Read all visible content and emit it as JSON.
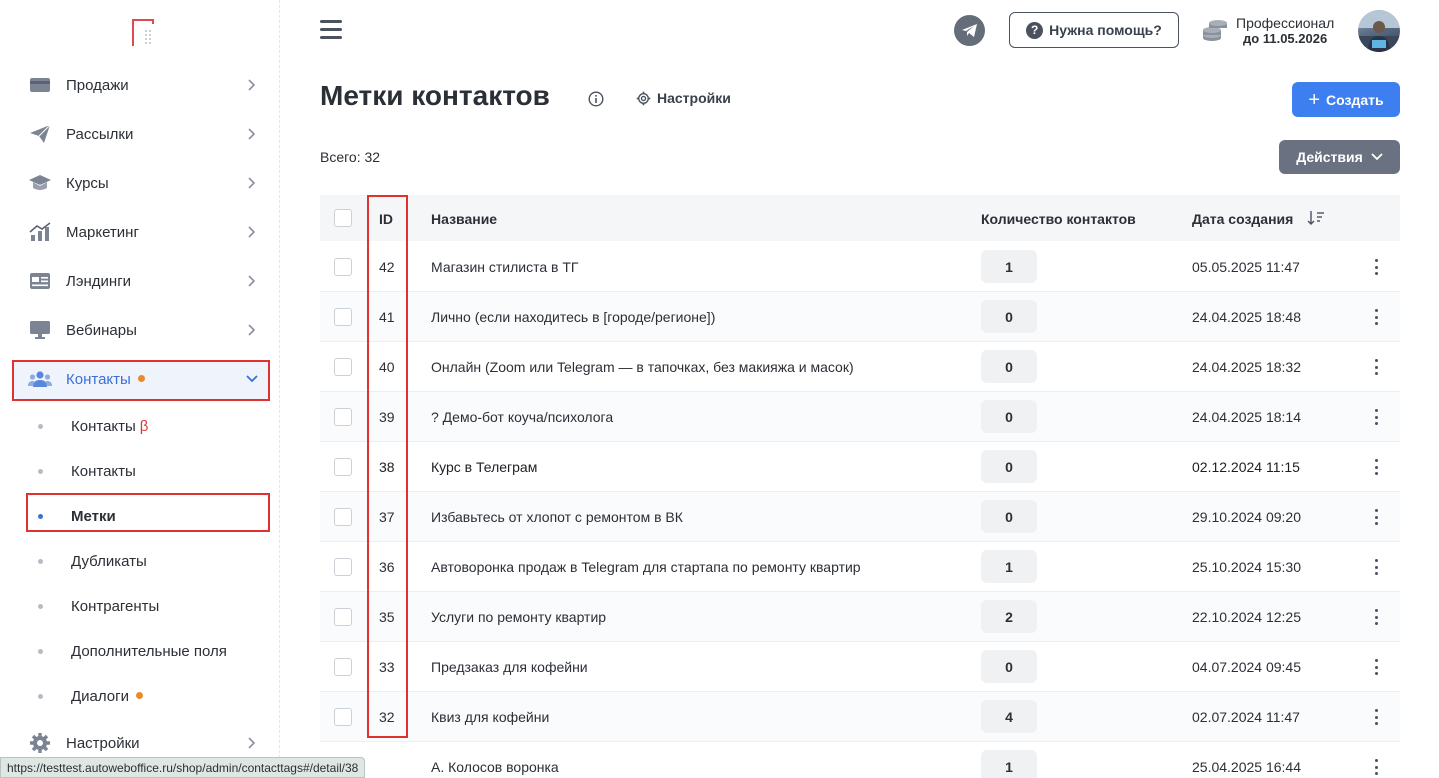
{
  "sidebar": {
    "items": [
      {
        "label": "Продажи",
        "icon": "wallet-icon"
      },
      {
        "label": "Рассылки",
        "icon": "paper-plane-icon"
      },
      {
        "label": "Курсы",
        "icon": "graduation-cap-icon"
      },
      {
        "label": "Маркетинг",
        "icon": "chart-icon"
      },
      {
        "label": "Лэндинги",
        "icon": "landing-page-icon"
      },
      {
        "label": "Вебинары",
        "icon": "monitor-icon"
      },
      {
        "label": "Контакты",
        "icon": "users-icon"
      },
      {
        "label": "Настройки",
        "icon": "gear-icon"
      }
    ],
    "submenu": [
      {
        "label": "Контакты",
        "badge": "β"
      },
      {
        "label": "Контакты"
      },
      {
        "label": "Метки"
      },
      {
        "label": "Дубликаты"
      },
      {
        "label": "Контрагенты"
      },
      {
        "label": "Дополнительные поля"
      },
      {
        "label": "Диалоги"
      }
    ]
  },
  "header": {
    "help_label": "Нужна помощь?",
    "plan_name": "Профессионал",
    "plan_date": "до 11.05.2026"
  },
  "page": {
    "title": "Метки контактов",
    "settings_label": "Настройки",
    "create_label": "Создать",
    "total_label": "Всего: 32",
    "actions_label": "Действия"
  },
  "table": {
    "headers": {
      "id": "ID",
      "name": "Название",
      "count": "Количество контактов",
      "date": "Дата создания"
    },
    "rows": [
      {
        "id": "42",
        "name": "Магазин стилиста в ТГ",
        "count": "1",
        "date": "05.05.2025 11:47"
      },
      {
        "id": "41",
        "name": "Лично (если находитесь в [городе/регионе])",
        "count": "0",
        "date": "24.04.2025 18:48"
      },
      {
        "id": "40",
        "name": "Онлайн (Zoom или Telegram — в тапочках, без макияжа и масок)",
        "count": "0",
        "date": "24.04.2025 18:32"
      },
      {
        "id": "39",
        "name": "? Демо-бот коуча/психолога",
        "count": "0",
        "date": "24.04.2025 18:14"
      },
      {
        "id": "38",
        "name": "Курс в Телеграм",
        "count": "0",
        "date": "02.12.2024 11:15"
      },
      {
        "id": "37",
        "name": "Избавьтесь от хлопот с ремонтом в ВК",
        "count": "0",
        "date": "29.10.2024 09:20"
      },
      {
        "id": "36",
        "name": "Автоворонка продаж в Telegram для стартапа по ремонту квартир",
        "count": "1",
        "date": "25.10.2024 15:30"
      },
      {
        "id": "35",
        "name": "Услуги по ремонту квартир",
        "count": "2",
        "date": "22.10.2024 12:25"
      },
      {
        "id": "33",
        "name": "Предзаказ для кофейни",
        "count": "0",
        "date": "04.07.2024 09:45"
      },
      {
        "id": "32",
        "name": "Квиз для кофейни",
        "count": "4",
        "date": "02.07.2024 11:47"
      },
      {
        "id": "",
        "name": "А. Колосов воронка",
        "count": "1",
        "date": "25.04.2025 16:44"
      }
    ]
  },
  "status_url": "https://testtest.autoweboffice.ru/shop/admin/contacttags#/detail/38",
  "colors": {
    "accent": "#3d7ff0",
    "active_nav": "#3d6fd8",
    "annotation": "#e03131",
    "badge_dot": "#e98a2c"
  }
}
